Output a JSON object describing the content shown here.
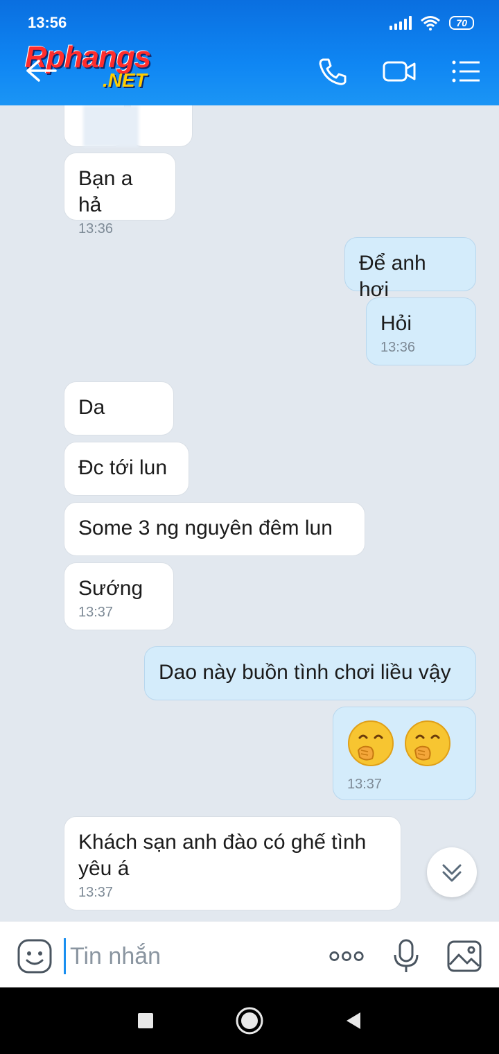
{
  "status": {
    "time": "13:56",
    "battery": "70"
  },
  "header": {
    "logo_main": "Rphangs",
    "logo_sub": ".NET",
    "icons": [
      "back-arrow-icon",
      "phone-icon",
      "video-icon",
      "menu-list-icon"
    ]
  },
  "colors": {
    "header": "#0f86f3",
    "incoming": "#ffffff",
    "outgoing": "#d4ecfb",
    "background": "#e2e8ef"
  },
  "messages": [
    {
      "dir": "in",
      "text": "Bạn a hả",
      "time": "13:36"
    },
    {
      "dir": "out",
      "text": "Để anh hơi",
      "time": ""
    },
    {
      "dir": "out",
      "text": "Hỏi",
      "time": "13:36"
    },
    {
      "dir": "in",
      "text": "Da",
      "time": ""
    },
    {
      "dir": "in",
      "text": "Đc tới lun",
      "time": ""
    },
    {
      "dir": "in",
      "text": "Some 3 ng nguyên đêm lun",
      "time": ""
    },
    {
      "dir": "in",
      "text": "Sướng",
      "time": "13:37"
    },
    {
      "dir": "out",
      "text": "Dao này buồn tình chơi liều vậy",
      "time": ""
    },
    {
      "dir": "out",
      "text": "",
      "emoji": [
        "hand-over-mouth-emoji",
        "hand-over-mouth-emoji"
      ],
      "time": "13:37"
    },
    {
      "dir": "in",
      "text": "Khách sạn anh đào có ghế tình yêu á",
      "time": "13:37"
    }
  ],
  "input": {
    "placeholder": "Tin nhắn"
  },
  "inputbar_icons": [
    "sticker-icon",
    "more-icon",
    "mic-icon",
    "image-icon"
  ],
  "navbar": [
    "recents-icon",
    "home-icon",
    "back-icon"
  ]
}
